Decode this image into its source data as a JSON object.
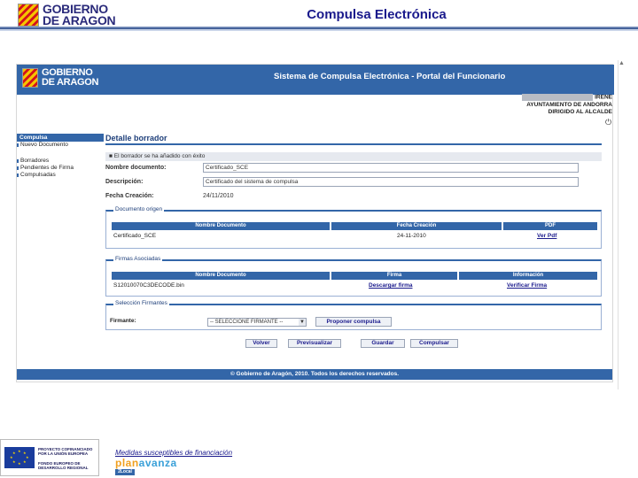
{
  "slide": {
    "logo_line1": "GOBIERNO",
    "logo_line2": "DE ARAGON",
    "title": "Compulsa Electrónica"
  },
  "portal": {
    "logo_line1": "GOBIERNO",
    "logo_line2": "DE ARAGON",
    "title": "Sistema de Compulsa Electrónica - Portal del Funcionario",
    "user": {
      "line1": "IRENE",
      "line2": "AYUNTAMIENTO DE ANDORRA",
      "line3": "DIRIGIDO AL ALCALDE"
    },
    "sidebar": {
      "header": "Compulsa",
      "items_top": [
        "Nuevo Documento"
      ],
      "items_bottom": [
        "Borradores",
        "Pendientes de Firma",
        "Compulsadas"
      ]
    },
    "main": {
      "title": "Detalle borrador",
      "info_message": "El borrador se ha añadido con éxito",
      "fields": {
        "name_label": "Nombre documento:",
        "name_value": "Certificado_SCE",
        "description_label": "Descripción:",
        "description_value": "Certificado del sistema de compulsa",
        "date_label": "Fecha Creación:",
        "date_value": "24/11/2010"
      },
      "original_doc": {
        "section_title": "Documento origen",
        "headers": [
          "Nombre Documento",
          "Fecha Creación",
          "PDF"
        ],
        "row": {
          "name": "Certificado_SCE",
          "date": "24-11-2010",
          "pdf_link": "Ver Pdf"
        }
      },
      "signatures": {
        "section_title": "Firmas Asociadas",
        "headers": [
          "Nombre Documento",
          "Firma",
          "Información"
        ],
        "row": {
          "name": "S12010070C3DECODE.bin",
          "download_link": "Descargar firma",
          "verify_link": "Verificar Firma"
        }
      },
      "signers": {
        "section_title": "Selección Firmantes",
        "signer_label": "Firmante:",
        "signer_value": "-- SELECCIONE FIRMANTE --",
        "propose_button": "Proponer compulsa"
      },
      "actions": [
        "Volver",
        "Previsualizar",
        "Guardar",
        "Compulsar"
      ]
    },
    "footer": "© Gobierno de Aragón, 2010. Todos los derechos reservados."
  },
  "bottom": {
    "eu_text": [
      "PROYECTO COFINANCIADO",
      "POR LA UNIÓN EUROPEA",
      "FONDO EUROPEO DE",
      "DESARROLLO REGIONAL"
    ],
    "funding_text": "Medidas susceptibles de financiación",
    "plan_logo_a": "plan",
    "plan_logo_b": "avanza",
    "plan_sub": "2Local"
  },
  "colors": {
    "portal_blue": "#3366a8",
    "title_navy": "#1a1a8c",
    "eu_blue": "#1a3c9c"
  }
}
